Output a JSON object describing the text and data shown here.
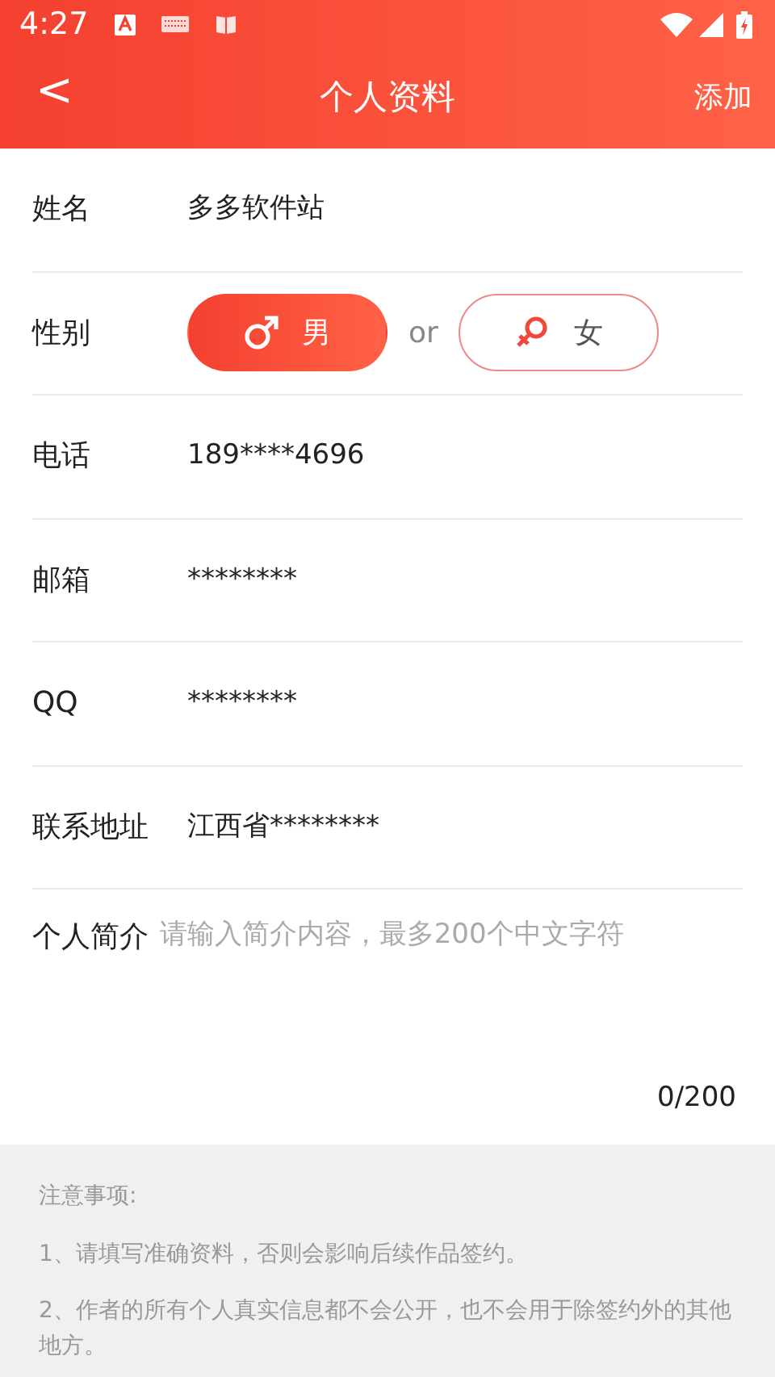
{
  "status_bar": {
    "time": "4:27"
  },
  "app_bar": {
    "back": "<",
    "title": "个人资料",
    "action": "添加"
  },
  "fields": [
    {
      "kind": "text",
      "label": "姓名",
      "value": "多多软件站"
    },
    {
      "kind": "gender",
      "label": "性别",
      "separator": "or",
      "options": [
        {
          "label": "男",
          "kind": "male",
          "selected": true
        },
        {
          "label": "女",
          "kind": "female",
          "selected": false
        }
      ]
    },
    {
      "kind": "text",
      "label": "电话",
      "value": "189****4696"
    },
    {
      "kind": "text",
      "label": "邮箱",
      "value": "********"
    },
    {
      "kind": "text",
      "label": "QQ",
      "value": "********"
    },
    {
      "kind": "text",
      "label": "联系地址",
      "value": "江西省********"
    },
    {
      "kind": "textarea",
      "label": "个人简介",
      "placeholder": "请输入简介内容，最多200个中文字符",
      "counter": "0/200"
    }
  ],
  "notes": {
    "title": "注意事项:",
    "items": [
      "1、请填写准确资料，否则会影响后续作品签约。",
      "2、作者的所有个人真实信息都不会公开，也不会用于除签约外的其他地方。"
    ]
  }
}
